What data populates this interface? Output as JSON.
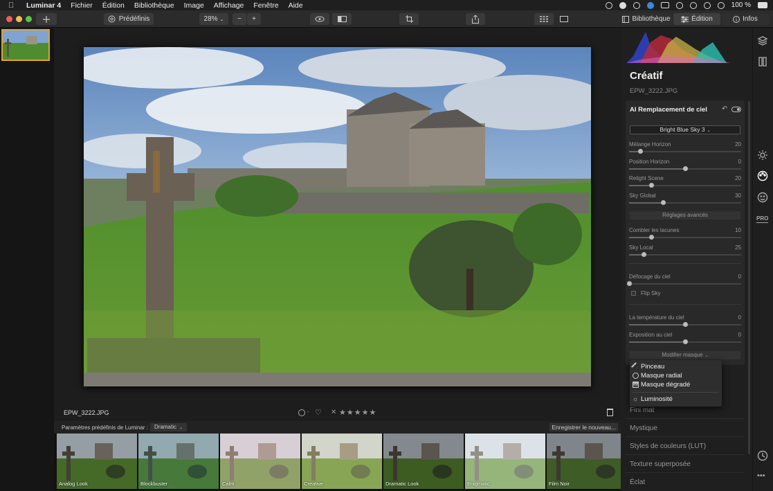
{
  "menubar": {
    "app_name": "Luminar 4",
    "items": [
      "Fichier",
      "Édition",
      "Bibliothèque",
      "Image",
      "Affichage",
      "Fenêtre",
      "Aide"
    ],
    "battery": "100 %"
  },
  "toolbar": {
    "presets_label": "Prédéfinis",
    "zoom": "28%",
    "zoom_minus": "−",
    "zoom_plus": "+",
    "tab_library": "Bibliothèque",
    "tab_edit": "Édition",
    "tab_info": "Infos"
  },
  "infobar": {
    "filename": "EPW_3222.JPG"
  },
  "presetbar": {
    "label": "Paramètres prédéfinis de Luminar :",
    "category": "Dramatic",
    "save_label": "Enregistrer le nouveau..."
  },
  "presets": [
    {
      "label": "Analog Look"
    },
    {
      "label": "Blockbuster"
    },
    {
      "label": "Calm"
    },
    {
      "label": "Creative"
    },
    {
      "label": "Dramatic Look"
    },
    {
      "label": "Enigmatic"
    },
    {
      "label": "Film Noir"
    }
  ],
  "panel": {
    "title": "Créatif",
    "filename": "EPW_3222.JPG",
    "card": {
      "title": "AI Remplacement de ciel",
      "sky_select": "Bright Blue Sky 3",
      "sliders_a": [
        {
          "label": "Mélange Horizon",
          "value": "20",
          "level": 0.1
        },
        {
          "label": "Position Horizon",
          "value": "0",
          "level": 0.5
        },
        {
          "label": "Relight Scene",
          "value": "20",
          "level": 0.2
        },
        {
          "label": "Sky Global",
          "value": "30",
          "level": 0.3
        }
      ],
      "advanced_label": "Réglages avancés",
      "sliders_b": [
        {
          "label": "Combler les lacunes",
          "value": "10",
          "level": 0.2
        },
        {
          "label": "Sky Local",
          "value": "25",
          "level": 0.13
        }
      ],
      "defocus": {
        "label": "Défocage du ciel",
        "value": "0",
        "level": 0.0
      },
      "flip_label": "Flip Sky",
      "sliders_c": [
        {
          "label": "La température du ciel",
          "value": "0",
          "level": 0.5
        },
        {
          "label": "Exposition au ciel",
          "value": "0",
          "level": 0.5
        }
      ],
      "mask_label": "Modifier masque"
    },
    "items": [
      "Fini mat",
      "Mystique",
      "Styles de couleurs (LUT)",
      "Texture superposée",
      "Éclat"
    ]
  },
  "mask_menu": {
    "items": [
      "Pinceau",
      "Masque radial",
      "Masque dégradé"
    ],
    "extra": "Luminosité"
  },
  "colors": {
    "accent_selected": "#e6a326",
    "sky": "#6d94c8",
    "grass": "#4d8a2c"
  }
}
